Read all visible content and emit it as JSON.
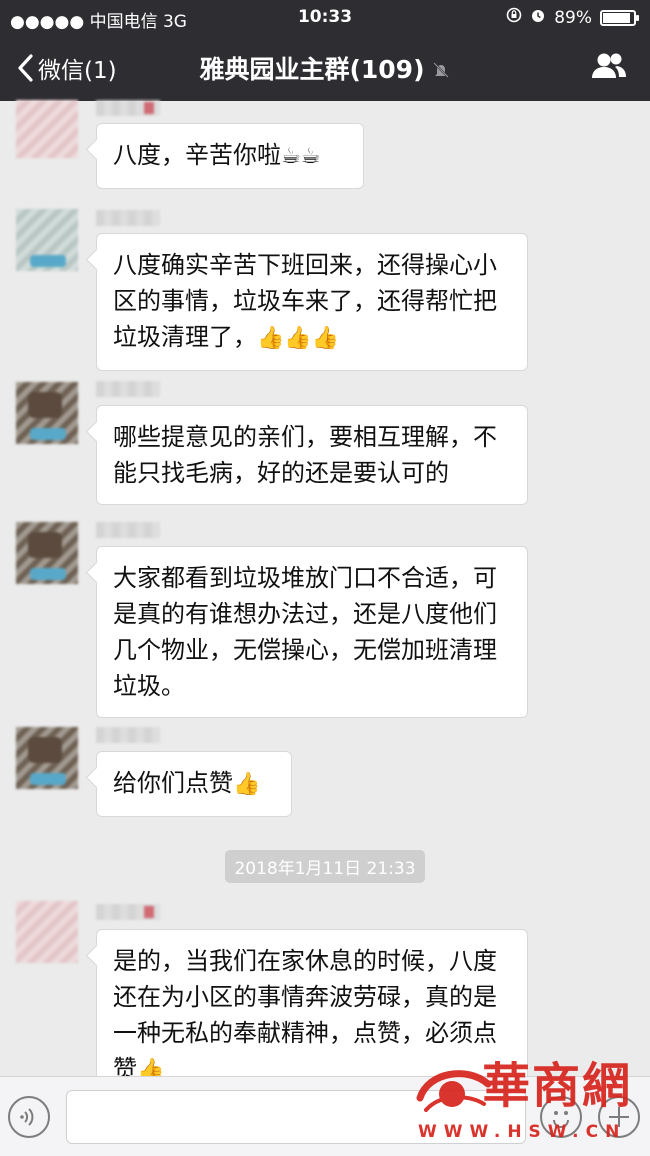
{
  "status_bar": {
    "carrier": "●●●●● 中国电信  3G",
    "time": "10:33",
    "battery_text": "89%",
    "battery_level": 0.89
  },
  "nav": {
    "back_label": "微信(1)",
    "title": "雅典园业主群(109)",
    "icons": [
      "chevron-left-icon",
      "mute-icon",
      "group-members-icon"
    ]
  },
  "messages": [
    {
      "text": "八度，辛苦你啦",
      "emoji": "☕☕"
    },
    {
      "text": "八度确实辛苦下班回来，还得操心小区的事情，垃圾车来了，还得帮忙把垃圾清理了，",
      "emoji": "👍👍👍"
    },
    {
      "text": "哪些提意见的亲们，要相互理解，不能只找毛病，好的还是要认可的",
      "emoji": ""
    },
    {
      "text": "大家都看到垃圾堆放门口不合适，可是真的有谁想办法过，还是八度他们几个物业，无偿操心，无偿加班清理垃圾。",
      "emoji": ""
    },
    {
      "text": "给你们点赞",
      "emoji": "👍"
    },
    {
      "text": "是的，当我们在家休息的时候，八度还在为小区的事情奔波劳碌，真的是一种无私的奉献精神，点赞，必须点赞",
      "emoji": "👍"
    }
  ],
  "timestamp": "2018年1月11日 21:33",
  "input_bar": {
    "icons": [
      "voice-icon",
      "emoji-icon",
      "plus-icon"
    ]
  },
  "watermark": {
    "name": "華商網",
    "url": "WWW.HSW.CN",
    "color": "#d6231c"
  }
}
